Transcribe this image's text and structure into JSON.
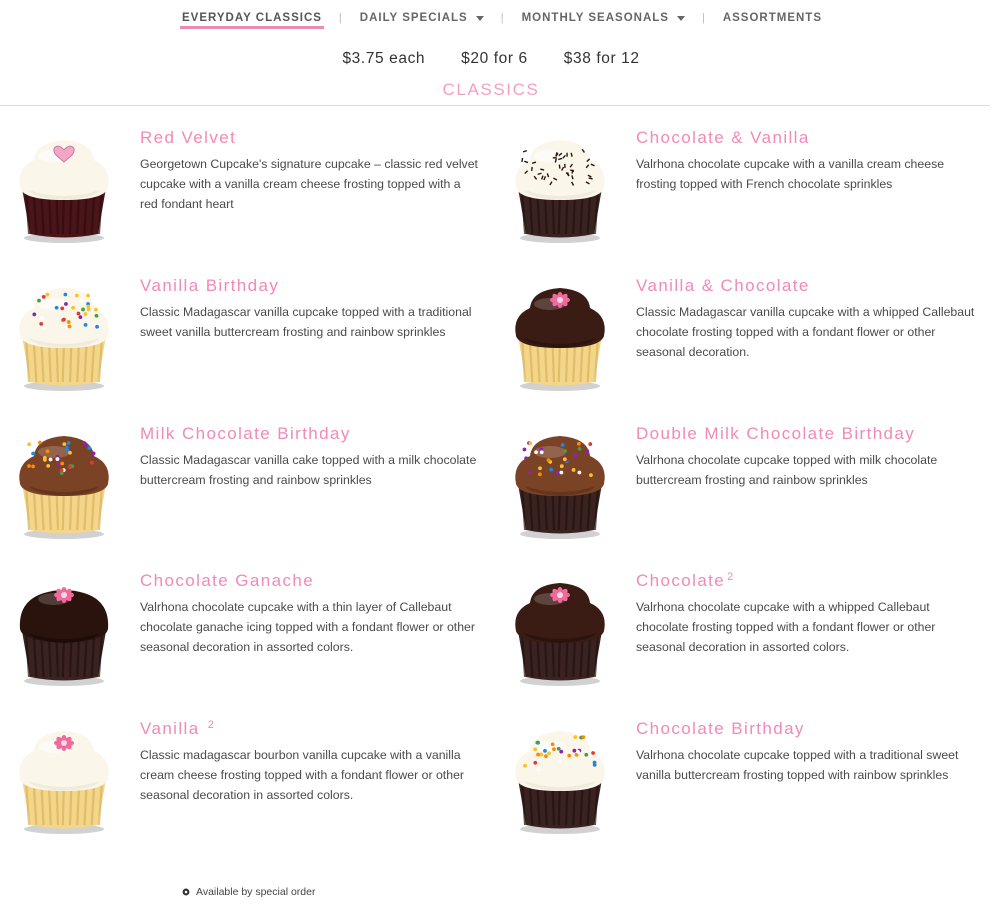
{
  "nav": {
    "items": [
      {
        "label": "EVERYDAY CLASSICS",
        "active": true,
        "dropdown": false
      },
      {
        "label": "DAILY SPECIALS",
        "active": false,
        "dropdown": true
      },
      {
        "label": "MONTHLY SEASONALS",
        "active": false,
        "dropdown": true
      },
      {
        "label": "ASSORTMENTS",
        "active": false,
        "dropdown": false
      }
    ]
  },
  "prices": [
    "$3.75 each",
    "$20 for 6",
    "$38 for 12"
  ],
  "section_title": "CLASSICS",
  "colors": {
    "accent": "#f08ab7",
    "underline": "#e88cb4"
  },
  "cupcakes": [
    {
      "name": "Red Velvet",
      "sup": "",
      "description": "Georgetown Cupcake's signature cupcake – classic red velvet cupcake with a vanilla cream cheese frosting topped with a red fondant heart",
      "cake": "red",
      "frosting": "cream",
      "topping": "heart"
    },
    {
      "name": "Chocolate & Vanilla",
      "sup": "",
      "description": "Valrhona chocolate cupcake with a vanilla cream cheese frosting topped with French chocolate sprinkles",
      "cake": "chocolate",
      "frosting": "cream",
      "topping": "choc-sprinkles"
    },
    {
      "name": "Vanilla Birthday",
      "sup": "",
      "description": "Classic Madagascar vanilla cupcake topped with a traditional sweet vanilla buttercream frosting and rainbow sprinkles",
      "cake": "vanilla",
      "frosting": "cream",
      "topping": "rainbow"
    },
    {
      "name": "Vanilla & Chocolate",
      "sup": "",
      "description": "Classic Madagascar vanilla cupcake with a whipped Callebaut chocolate frosting topped with a fondant flower or other seasonal decoration.",
      "cake": "vanilla",
      "frosting": "dark",
      "topping": "flower"
    },
    {
      "name": "Milk Chocolate Birthday",
      "sup": "",
      "description": "Classic Madagascar vanilla cake topped with a milk chocolate buttercream frosting and rainbow sprinkles",
      "cake": "vanilla",
      "frosting": "milk",
      "topping": "rainbow"
    },
    {
      "name": "Double Milk Chocolate Birthday",
      "sup": "",
      "description": "Valrhona chocolate cupcake topped with milk chocolate buttercream frosting and rainbow sprinkles",
      "cake": "chocolate",
      "frosting": "milk",
      "topping": "rainbow"
    },
    {
      "name": "Chocolate Ganache",
      "sup": "",
      "description": "Valrhona chocolate cupcake with a thin layer of Callebaut chocolate ganache icing topped with a fondant flower or other seasonal decoration in assorted colors.",
      "cake": "chocolate",
      "frosting": "ganache",
      "topping": "flower"
    },
    {
      "name": "Chocolate",
      "sup": "2",
      "description": "Valrhona chocolate cupcake with a whipped Callebaut chocolate frosting topped with a fondant flower or other seasonal decoration in assorted colors.",
      "cake": "chocolate",
      "frosting": "dark",
      "topping": "flower"
    },
    {
      "name": "Vanilla ",
      "sup": "2",
      "description": "Classic madagascar bourbon vanilla cupcake with a vanilla cream cheese frosting topped with a fondant flower or other seasonal decoration in assorted colors.",
      "cake": "vanilla",
      "frosting": "cream",
      "topping": "flower"
    },
    {
      "name": "Chocolate Birthday",
      "sup": "",
      "description": "Valrhona chocolate cupcake topped with a traditional sweet vanilla buttercream frosting topped with rainbow sprinkles",
      "cake": "chocolate",
      "frosting": "cream",
      "topping": "rainbow"
    }
  ],
  "footnote": {
    "text": "Available by special order",
    "icon": "special-order-icon"
  }
}
